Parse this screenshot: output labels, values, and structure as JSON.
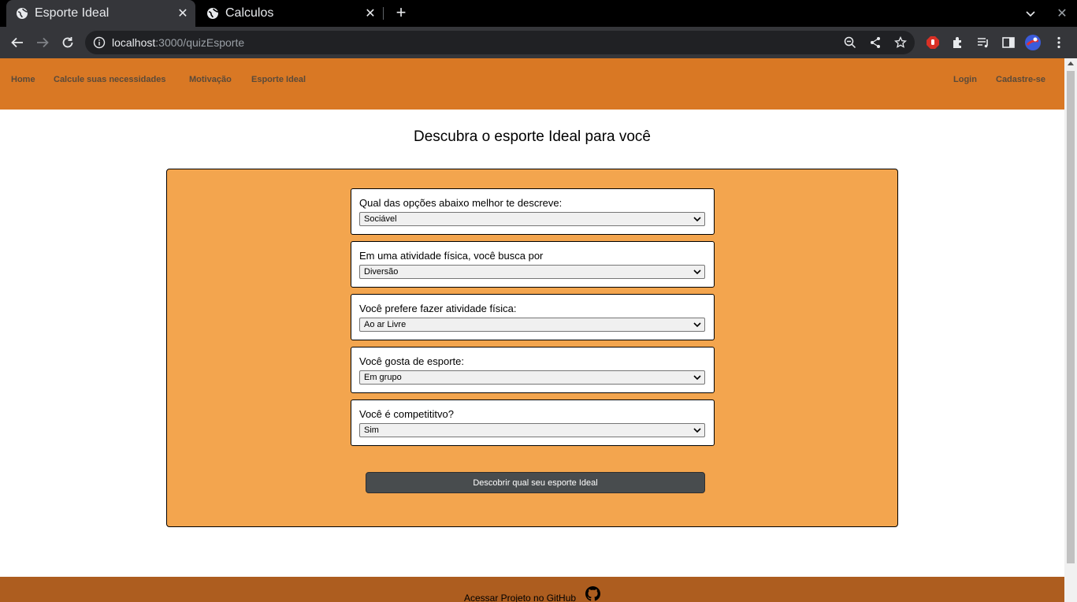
{
  "browser": {
    "tabs": [
      {
        "title": "Esporte Ideal",
        "active": true
      },
      {
        "title": "Calculos",
        "active": false
      }
    ],
    "url_host": "localhost",
    "url_path": ":3000/quizEsporte"
  },
  "nav": {
    "left": [
      "Home",
      "Calcule suas necessidades",
      "Motivação",
      "Esporte Ideal"
    ],
    "login": "Login",
    "signup": "Cadastre-se"
  },
  "main": {
    "heading": "Descubra o esporte Ideal para você",
    "questions": [
      {
        "label": "Qual das opções abaixo melhor te descreve:",
        "selected": "Sociável"
      },
      {
        "label": "Em uma atividade física, você busca por",
        "selected": "Diversão"
      },
      {
        "label": "Você prefere fazer atividade física:",
        "selected": "Ao ar Livre"
      },
      {
        "label": "Você gosta de esporte:",
        "selected": "Em grupo"
      },
      {
        "label": "Você é competititvo?",
        "selected": "Sim"
      }
    ],
    "submit_label": "Descobrir qual seu esporte Ideal"
  },
  "footer": {
    "text": "Acessar Projeto no GitHub"
  },
  "colors": {
    "navbar": "#d97824",
    "quizbox": "#f3a54e",
    "footer": "#ad5d1f",
    "button": "#484c4e"
  }
}
